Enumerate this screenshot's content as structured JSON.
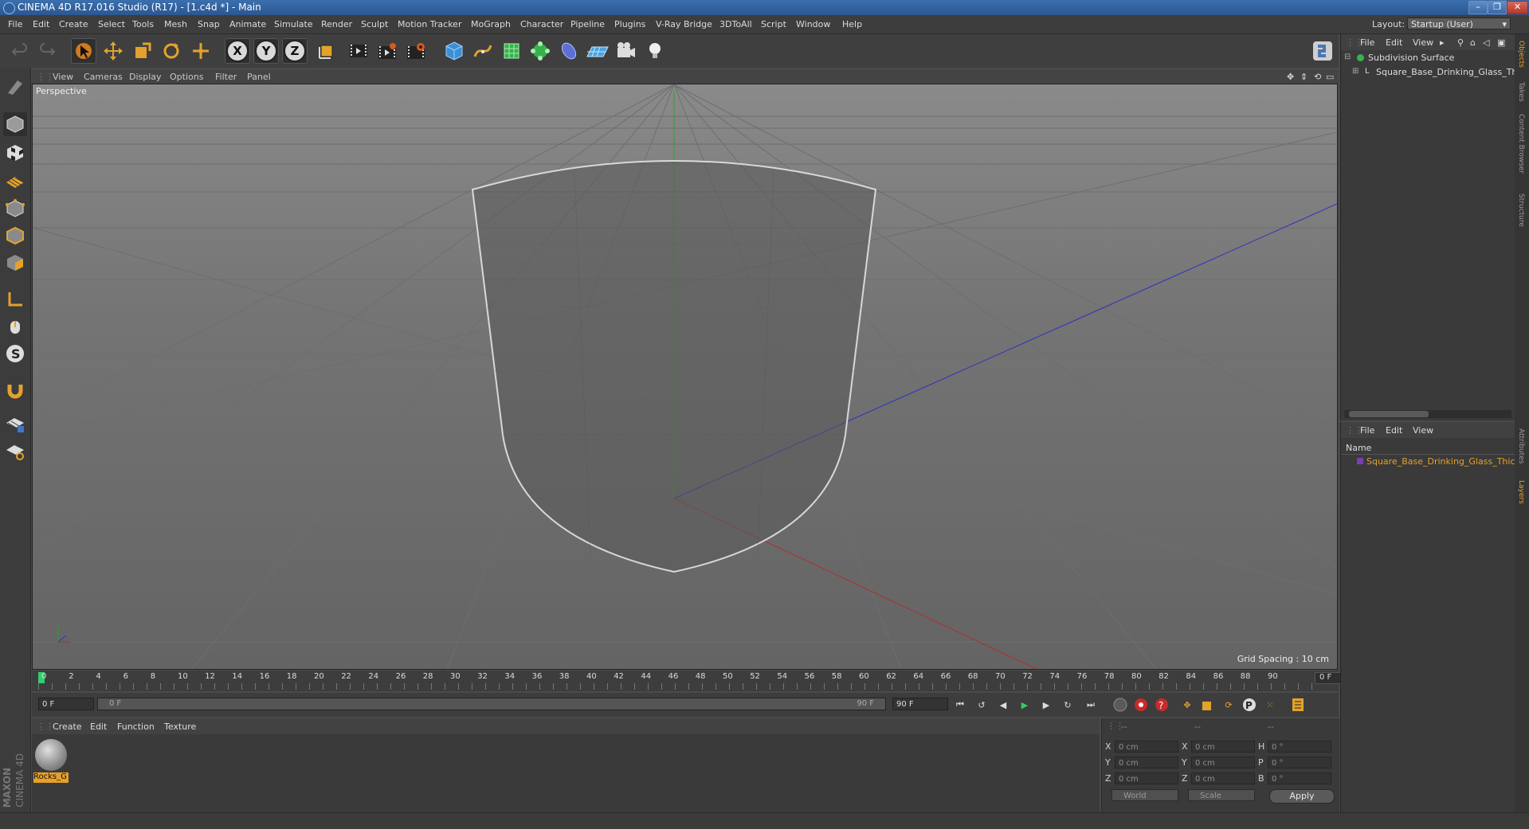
{
  "window": {
    "title": "CINEMA 4D R17.016 Studio (R17) - [1.c4d *] - Main",
    "minimize": "–",
    "restore": "❐",
    "close": "✕"
  },
  "menubar": {
    "items": [
      "File",
      "Edit",
      "Create",
      "Select",
      "Tools",
      "Mesh",
      "Snap",
      "Animate",
      "Simulate",
      "Render",
      "Sculpt",
      "Motion Tracker",
      "MoGraph",
      "Character",
      "Pipeline",
      "Plugins",
      "V-Ray Bridge",
      "3DToAll",
      "Script",
      "Window",
      "Help"
    ],
    "layout_label": "Layout:",
    "layout_value": "Startup (User)"
  },
  "toolbar": {
    "axis_x": "X",
    "axis_y": "Y",
    "axis_z": "Z",
    "icons": [
      "undo-icon",
      "redo-icon",
      "select-arrow-icon",
      "move-icon",
      "scale-icon",
      "rotate-icon",
      "live-transform-icon",
      "x-axis-icon",
      "y-axis-icon",
      "z-axis-icon",
      "world-coord-icon",
      "render-view-icon",
      "render-picture-viewer-icon",
      "render-settings-icon",
      "cube-icon",
      "pen-spline-icon",
      "subdivision-icon",
      "array-icon",
      "deformer-icon",
      "floor-icon",
      "camera-icon",
      "light-icon"
    ]
  },
  "viewport": {
    "menu": [
      "View",
      "Cameras",
      "Display",
      "Options",
      "Filter",
      "Panel"
    ],
    "label": "Perspective",
    "grid_spacing": "Grid Spacing : 10 cm"
  },
  "timeline": {
    "ticks": [
      "0",
      "2",
      "4",
      "6",
      "8",
      "10",
      "12",
      "14",
      "16",
      "18",
      "20",
      "22",
      "24",
      "26",
      "28",
      "30",
      "32",
      "34",
      "36",
      "38",
      "40",
      "42",
      "44",
      "46",
      "48",
      "50",
      "52",
      "54",
      "56",
      "58",
      "60",
      "62",
      "64",
      "66",
      "68",
      "70",
      "72",
      "74",
      "76",
      "78",
      "80",
      "82",
      "84",
      "86",
      "88",
      "90"
    ],
    "current": "0 F",
    "start_field": "0 F",
    "range_start": "0 F",
    "range_end": "90 F",
    "end_field": "90 F"
  },
  "materials": {
    "menu": [
      "Create",
      "Edit",
      "Function",
      "Texture"
    ],
    "items": [
      {
        "name": "Rocks_G"
      }
    ]
  },
  "coordinates": {
    "header": [
      "--",
      "--",
      "--"
    ],
    "rows": [
      {
        "axis": "X",
        "pos": "0 cm",
        "size_axis": "X",
        "size": "0 cm",
        "rot_axis": "H",
        "rot": "0 °"
      },
      {
        "axis": "Y",
        "pos": "0 cm",
        "size_axis": "Y",
        "size": "0 cm",
        "rot_axis": "P",
        "rot": "0 °"
      },
      {
        "axis": "Z",
        "pos": "0 cm",
        "size_axis": "Z",
        "size": "0 cm",
        "rot_axis": "B",
        "rot": "0 °"
      }
    ],
    "space": "World",
    "mode": "Scale",
    "apply": "Apply"
  },
  "object_manager": {
    "menu": [
      "File",
      "Edit",
      "View"
    ],
    "tree": [
      "Subdivision Surface",
      "Square_Base_Drinking_Glass_Thi"
    ]
  },
  "layer_manager": {
    "menu": [
      "File",
      "Edit",
      "View"
    ],
    "column": "Name",
    "items": [
      "Square_Base_Drinking_Glass_Thic"
    ]
  },
  "side_tabs": [
    "Objects",
    "Takes",
    "Content Browser",
    "Structure",
    "Attributes",
    "Layers"
  ],
  "branding": {
    "maxon": "MAXON",
    "product": "CINEMA 4D"
  },
  "colors": {
    "accent_orange": "#e6a12a",
    "selection_blue": "#3d77c9",
    "x_axis": "#b03030",
    "y_axis": "#2fa02f",
    "z_axis": "#3030c0"
  }
}
